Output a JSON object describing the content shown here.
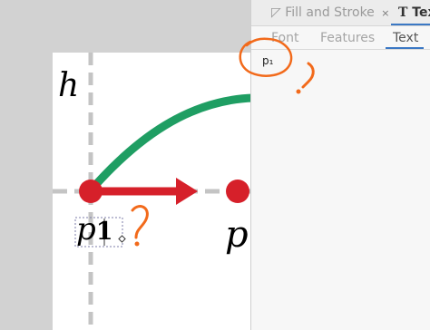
{
  "dialog": {
    "tabs": [
      {
        "label": "Fill and Stroke",
        "icon": "fill-stroke-icon",
        "close": "×"
      },
      {
        "label": "Tex",
        "icon": "text-tool-icon"
      }
    ],
    "subtabs": [
      "Font",
      "Features",
      "Text"
    ],
    "text_value": "p₁"
  },
  "canvas": {
    "label_h": "h",
    "label_p1": "p",
    "label_p1_sub": "1",
    "label_p2": "p"
  },
  "colors": {
    "green_curve": "#1f9e63",
    "red_point": "#d6202a",
    "annotation_orange": "#f26a1b",
    "axis_gray": "#c4c4c4"
  }
}
